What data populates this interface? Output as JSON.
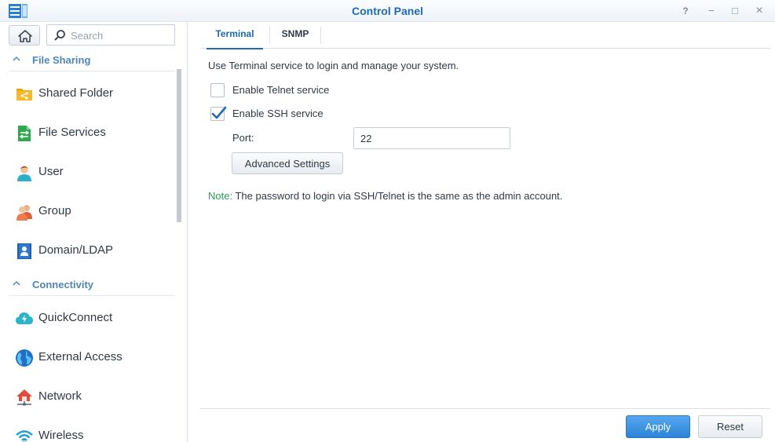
{
  "window": {
    "title": "Control Panel",
    "help_glyph": "?",
    "minimize_glyph": "−",
    "maximize_glyph": "□",
    "close_glyph": "×"
  },
  "sidebar": {
    "search_placeholder": "Search",
    "sections": [
      {
        "label": "File Sharing",
        "items": [
          {
            "label": "Shared Folder",
            "icon": "shared-folder-icon"
          },
          {
            "label": "File Services",
            "icon": "file-services-icon"
          },
          {
            "label": "User",
            "icon": "user-icon"
          },
          {
            "label": "Group",
            "icon": "group-icon"
          },
          {
            "label": "Domain/LDAP",
            "icon": "domain-ldap-icon"
          }
        ]
      },
      {
        "label": "Connectivity",
        "items": [
          {
            "label": "QuickConnect",
            "icon": "quickconnect-icon"
          },
          {
            "label": "External Access",
            "icon": "external-access-icon"
          },
          {
            "label": "Network",
            "icon": "network-icon"
          },
          {
            "label": "Wireless",
            "icon": "wireless-icon"
          }
        ]
      }
    ]
  },
  "tabs": [
    {
      "label": "Terminal",
      "active": true
    },
    {
      "label": "SNMP",
      "active": false
    }
  ],
  "terminal": {
    "description": "Use Terminal service to login and manage your system.",
    "telnet_label": "Enable Telnet service",
    "telnet_checked": false,
    "ssh_label": "Enable SSH service",
    "ssh_checked": true,
    "port_label": "Port:",
    "port_value": "22",
    "advanced_label": "Advanced Settings",
    "note_tag": "Note:",
    "note_text": " The password to login via SSH/Telnet is the same as the admin account."
  },
  "footer": {
    "apply_label": "Apply",
    "reset_label": "Reset"
  },
  "colors": {
    "accent": "#1e6ab3",
    "section_header": "#4f86b6",
    "note_green": "#2e9a5a",
    "apply_blue": "#3a8fe0"
  }
}
